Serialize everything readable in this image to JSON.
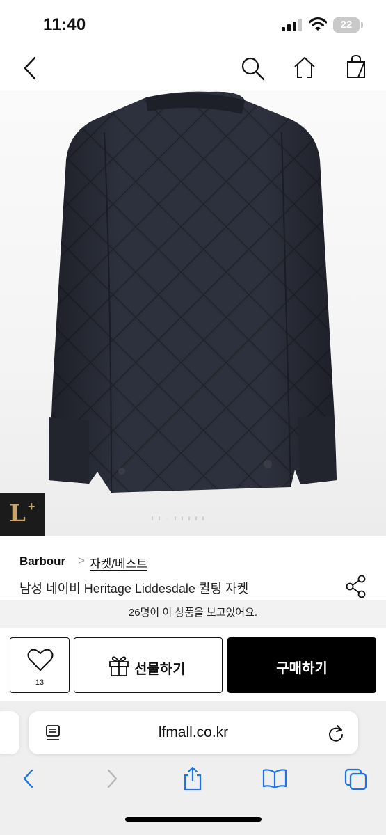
{
  "status_bar": {
    "time": "11:40",
    "battery": "22"
  },
  "nav": {
    "back": "back-arrow",
    "search": "search-icon",
    "home": "home-icon",
    "cart": "shopping-bag-icon"
  },
  "product": {
    "brand": "Barbour",
    "breadcrumb_separator": ">",
    "category": "자켓/베스트",
    "name": "남성 네이비 Heritage Liddesdale 퀼팅 자켓",
    "image_count": 8,
    "active_image": 3,
    "jacket_color": "#2b2f3a"
  },
  "badge": {
    "letter": "L",
    "plus": "+"
  },
  "viewers_text": "26명이 이 상품을 보고있어요.",
  "actions": {
    "wish_count": "13",
    "gift_label": "선물하기",
    "buy_label": "구매하기"
  },
  "browser": {
    "url": "lfmall.co.kr"
  },
  "colors": {
    "primary": "#000000",
    "badge_bg": "#1b1b1b",
    "badge_gold": "#c9a66b",
    "safari_blue": "#1a73e8"
  }
}
